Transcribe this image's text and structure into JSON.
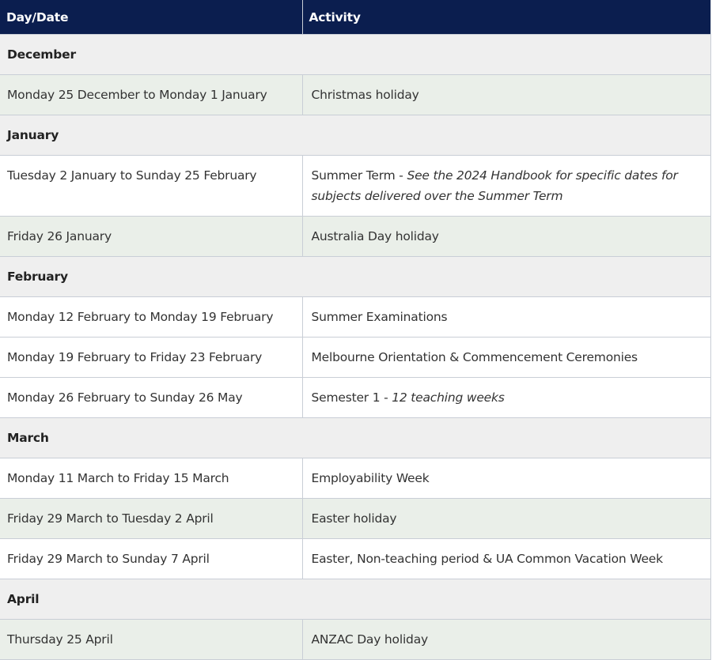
{
  "header": {
    "col_date": "Day/Date",
    "col_activity": "Activity"
  },
  "rows": [
    {
      "type": "month",
      "label": "December"
    },
    {
      "type": "item",
      "shade": true,
      "date": "Monday 25 December to Monday 1 January",
      "activity": "Christmas holiday"
    },
    {
      "type": "month",
      "label": "January"
    },
    {
      "type": "item",
      "shade": false,
      "date": "Tuesday 2 January to Sunday 25 February",
      "activity": "Summer Term",
      "note": "See the 2024 Handbook for specific dates for subjects delivered over the Summer Term"
    },
    {
      "type": "item",
      "shade": true,
      "date": "Friday 26 January",
      "activity": "Australia Day holiday"
    },
    {
      "type": "month",
      "label": "February"
    },
    {
      "type": "item",
      "shade": false,
      "date": "Monday 12 February to Monday 19 February",
      "activity": "Summer Examinations"
    },
    {
      "type": "item",
      "shade": false,
      "date": "Monday 19 February to Friday 23 February",
      "activity": "Melbourne Orientation & Commencement Ceremonies"
    },
    {
      "type": "item",
      "shade": false,
      "date": "Monday 26 February to Sunday 26 May",
      "activity": "Semester 1",
      "note": "12 teaching weeks"
    },
    {
      "type": "month",
      "label": "March"
    },
    {
      "type": "item",
      "shade": false,
      "date": "Monday 11 March to Friday 15 March",
      "activity": "Employability Week"
    },
    {
      "type": "item",
      "shade": true,
      "date": "Friday 29 March to Tuesday 2 April",
      "activity": "Easter holiday"
    },
    {
      "type": "item",
      "shade": false,
      "date": "Friday 29 March to Sunday 7 April",
      "activity": "Easter, Non-teaching period & UA Common Vacation Week"
    },
    {
      "type": "month",
      "label": "April"
    },
    {
      "type": "item",
      "shade": true,
      "date": "Thursday 25 April",
      "activity": "ANZAC Day holiday"
    }
  ]
}
